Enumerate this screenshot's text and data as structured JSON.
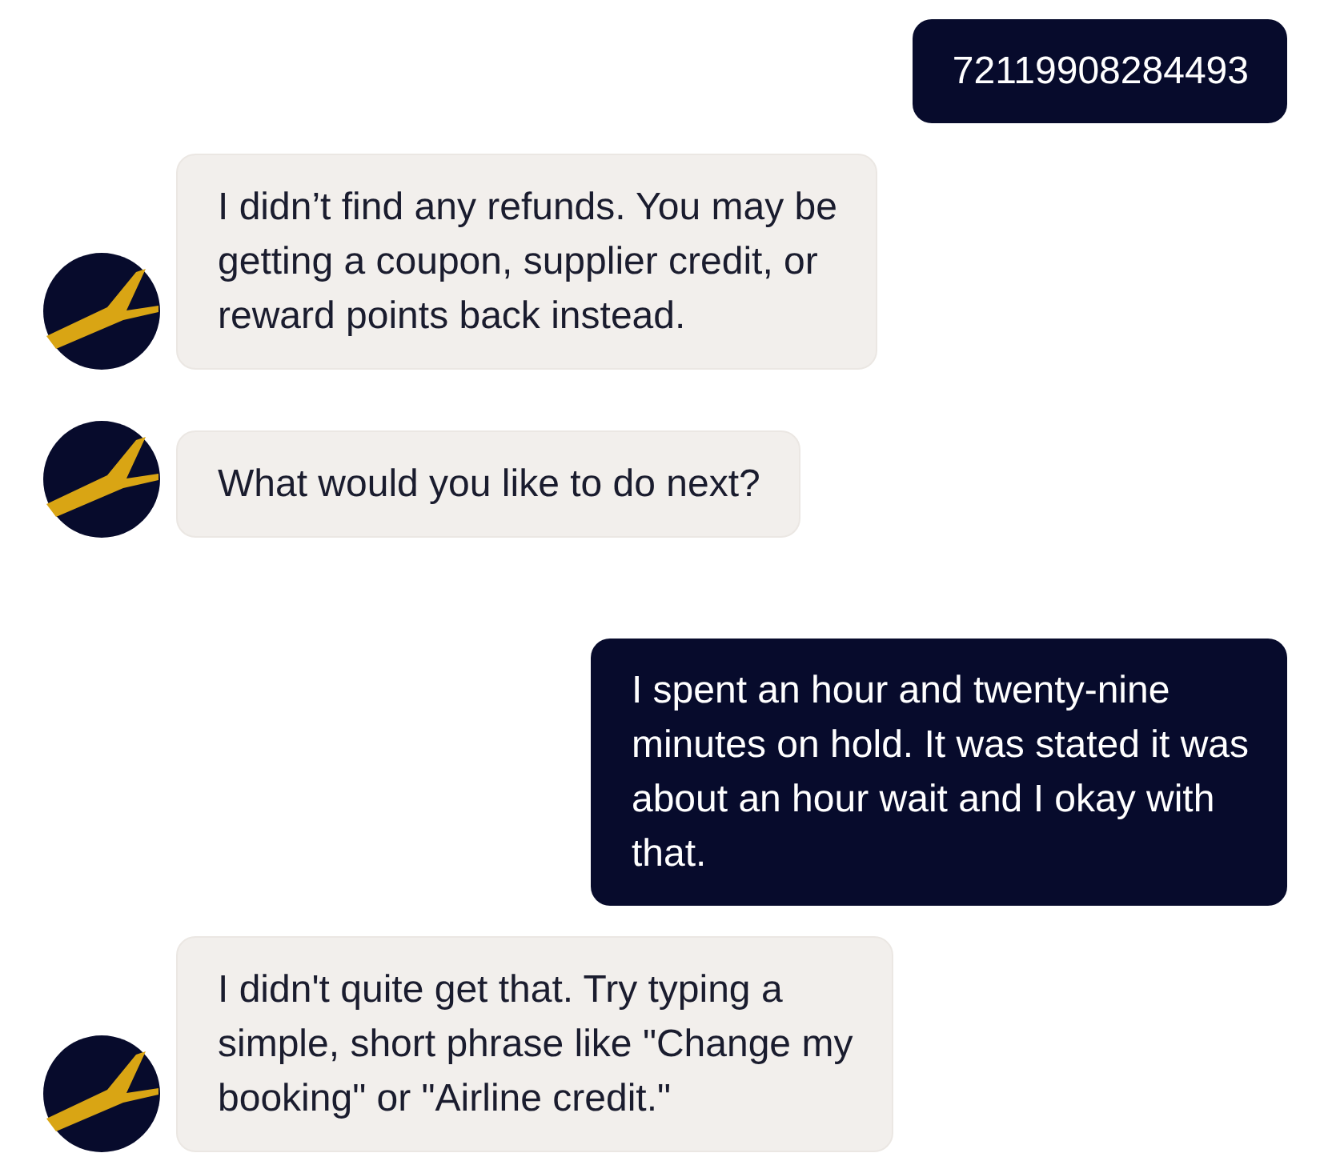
{
  "messages": [
    {
      "kind": "outgoing",
      "lines": [
        "72119908284493"
      ]
    },
    {
      "kind": "incoming",
      "lines": [
        "I didn’t find any refunds. You may be",
        "getting a coupon, supplier credit, or",
        "reward points back instead."
      ]
    },
    {
      "kind": "incoming",
      "lines": [
        "What would you like to do next?"
      ]
    },
    {
      "kind": "outgoing",
      "lines": [
        "I spent an hour and twenty-nine",
        "minutes on hold. It was stated it was",
        "about an hour wait and I okay with",
        "that."
      ]
    },
    {
      "kind": "incoming",
      "lines": [
        "I didn't quite get that. Try typing a",
        "simple, short phrase like \"Change my",
        "booking\" or \"Airline credit.\""
      ]
    }
  ]
}
